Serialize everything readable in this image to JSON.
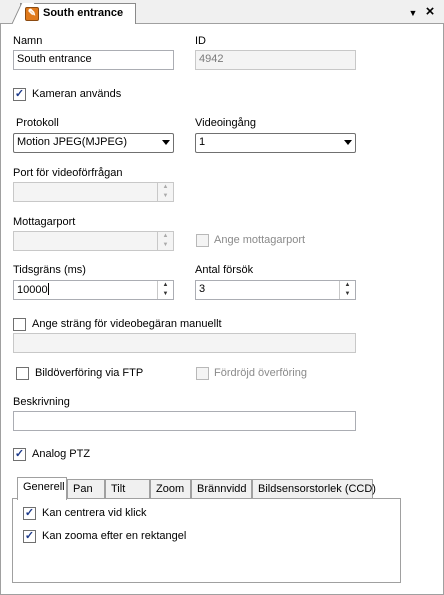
{
  "window": {
    "tab_title": "South entrance",
    "menu_arrow": "▼",
    "close": "×"
  },
  "form": {
    "name_label": "Namn",
    "name_value": "South entrance",
    "id_label": "ID",
    "id_value": "4942",
    "camera_used_label": "Kameran används",
    "camera_used_checked": true,
    "protocol_label": "Protokoll",
    "protocol_value": "Motion JPEG(MJPEG)",
    "video_input_label": "Videoingång",
    "video_input_value": "1",
    "video_port_label": "Port för videoförfrågan",
    "video_port_value": "",
    "receiver_port_label": "Mottagarport",
    "receiver_port_value": "",
    "set_receiver_port_label": "Ange mottagarport",
    "timeout_label": "Tidsgräns (ms)",
    "timeout_value": "10000",
    "retries_label": "Antal försök",
    "retries_value": "3",
    "manual_string_label": "Ange sträng för videobegäran manuellt",
    "manual_string_value": "",
    "ftp_label": "Bildöverföring via FTP",
    "delayed_label": "Fördröjd överföring",
    "description_label": "Beskrivning",
    "description_value": "",
    "analog_ptz_label": "Analog PTZ",
    "analog_ptz_checked": true
  },
  "ptz_tabs": [
    {
      "label": "Generell"
    },
    {
      "label": "Pan"
    },
    {
      "label": "Tilt"
    },
    {
      "label": "Zoom"
    },
    {
      "label": "Brännvidd"
    },
    {
      "label": "Bildsensorstorlek (CCD)"
    }
  ],
  "general_tab": {
    "can_center_label": "Kan centrera vid klick",
    "can_center_checked": true,
    "can_zoom_rect_label": "Kan zooma efter en rektangel",
    "can_zoom_rect_checked": true
  },
  "glyphs": {
    "check": "✓",
    "spin_up": "▲",
    "spin_down": "▼"
  },
  "colors": {
    "icon_accent": "#e07a1c",
    "check_color": "#1e3b8a"
  }
}
